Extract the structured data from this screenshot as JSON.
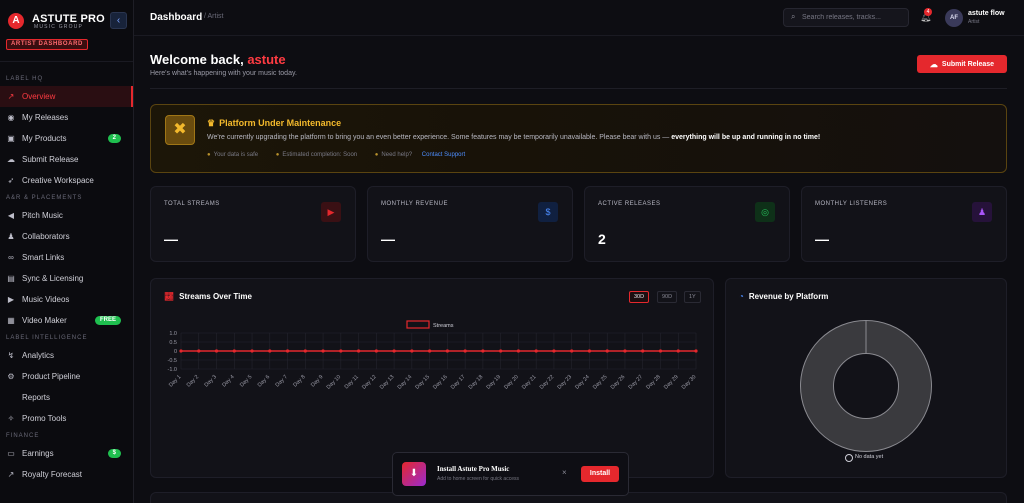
{
  "brand": {
    "name": "ASTUTE PRO",
    "subtitle": "MUSIC GROUP",
    "badge": "ARTIST DASHBOARD"
  },
  "sidebar": {
    "sections": [
      {
        "title": "LABEL HQ",
        "items": [
          {
            "label": "Overview",
            "icon": "chart-line-icon",
            "active": true
          },
          {
            "label": "My Releases",
            "icon": "disc-icon"
          },
          {
            "label": "My Products",
            "icon": "box-icon",
            "badge": "2"
          },
          {
            "label": "Submit Release",
            "icon": "cloud-upload-icon"
          },
          {
            "label": "Creative Workspace",
            "icon": "rocket-icon"
          }
        ]
      },
      {
        "title": "A&R & PLACEMENTS",
        "items": [
          {
            "label": "Pitch Music",
            "icon": "megaphone-icon"
          },
          {
            "label": "Collaborators",
            "icon": "users-icon"
          },
          {
            "label": "Smart Links",
            "icon": "link-icon"
          },
          {
            "label": "Sync & Licensing",
            "icon": "film-icon"
          },
          {
            "label": "Music Videos",
            "icon": "video-icon"
          },
          {
            "label": "Video Maker",
            "icon": "clapper-icon",
            "badge": "FREE"
          }
        ]
      },
      {
        "title": "LABEL INTELLIGENCE",
        "items": [
          {
            "label": "Analytics",
            "icon": "analytics-icon"
          },
          {
            "label": "Product Pipeline",
            "icon": "pipeline-icon"
          },
          {
            "label": "Reports",
            "icon": ""
          },
          {
            "label": "Promo Tools",
            "icon": "magic-wand-icon"
          }
        ]
      },
      {
        "title": "FINANCE",
        "items": [
          {
            "label": "Earnings",
            "icon": "wallet-icon",
            "badge": "$"
          },
          {
            "label": "Royalty Forecast",
            "icon": "forecast-icon"
          }
        ]
      }
    ]
  },
  "header": {
    "title": "Dashboard",
    "crumb": "/ Artist",
    "search_placeholder": "Search releases, tracks...",
    "notifications": "4",
    "avatar": "AF",
    "user_name": "astute flow",
    "user_role": "Artist"
  },
  "welcome": {
    "prefix": "Welcome back,",
    "name": "astute",
    "subtitle": "Here's what's happening with your music today.",
    "submit_label": "Submit Release"
  },
  "maintenance": {
    "title": "Platform Under Maintenance",
    "text": "We're currently upgrading the platform to bring you an even better experience. Some features may be temporarily unavailable. Please bear with us —",
    "text_bold": "everything will be up and running in no time!",
    "meta_safe": "Your data is safe",
    "meta_eta": "Estimated completion: Soon",
    "meta_help": "Need help?",
    "meta_link": "Contact Support"
  },
  "stats": [
    {
      "label": "TOTAL STREAMS",
      "value": "—",
      "icon": "play-icon",
      "color": "#e5282d",
      "bg": "#3a1014"
    },
    {
      "label": "MONTHLY REVENUE",
      "value": "—",
      "icon": "dollar-icon",
      "color": "#4d8eff",
      "bg": "#102040"
    },
    {
      "label": "ACTIVE RELEASES",
      "value": "2",
      "icon": "vinyl-icon",
      "color": "#26c35a",
      "bg": "#0e3018"
    },
    {
      "label": "MONTHLY LISTENERS",
      "value": "—",
      "icon": "users-icon",
      "color": "#a855f7",
      "bg": "#26123a"
    }
  ],
  "streams_chart": {
    "title": "Streams Over Time",
    "ranges": [
      "30D",
      "90D",
      "1Y"
    ],
    "active_range": "30D",
    "chart_data": {
      "type": "line",
      "title": "Streams Over Time",
      "x": [
        "Day 1",
        "Day 2",
        "Day 3",
        "Day 4",
        "Day 5",
        "Day 6",
        "Day 7",
        "Day 8",
        "Day 9",
        "Day 10",
        "Day 11",
        "Day 12",
        "Day 13",
        "Day 14",
        "Day 15",
        "Day 16",
        "Day 17",
        "Day 18",
        "Day 19",
        "Day 20",
        "Day 21",
        "Day 22",
        "Day 23",
        "Day 24",
        "Day 25",
        "Day 26",
        "Day 27",
        "Day 28",
        "Day 29",
        "Day 30"
      ],
      "series": [
        {
          "name": "Streams",
          "values": [
            0,
            0,
            0,
            0,
            0,
            0,
            0,
            0,
            0,
            0,
            0,
            0,
            0,
            0,
            0,
            0,
            0,
            0,
            0,
            0,
            0,
            0,
            0,
            0,
            0,
            0,
            0,
            0,
            0,
            0
          ]
        }
      ],
      "yticks": [
        "1.0",
        "0.5",
        "0",
        "-0.5",
        "-1.0"
      ],
      "ylim": [
        -1,
        1
      ],
      "legend": "top-center",
      "color": "#e5282d"
    }
  },
  "revenue_chart": {
    "title": "Revenue by Platform",
    "no_data": "No data yet",
    "chart_data": {
      "type": "pie",
      "values": [],
      "labels": []
    }
  },
  "install": {
    "title": "Install Astute Pro Music",
    "subtitle": "Add to home screen for quick access",
    "close": "×",
    "button": "Install"
  }
}
